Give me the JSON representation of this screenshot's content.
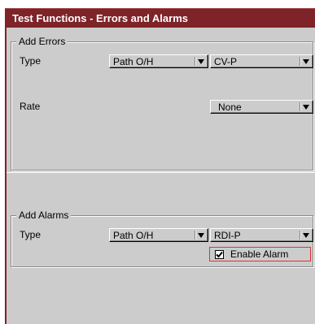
{
  "window": {
    "title": "Test Functions - Errors and Alarms"
  },
  "errors": {
    "legend": "Add Errors",
    "type_label": "Type",
    "type_primary": "Path O/H",
    "type_secondary": "CV-P",
    "rate_label": "Rate",
    "rate_value": "None"
  },
  "alarms": {
    "legend": "Add Alarms",
    "type_label": "Type",
    "type_primary": "Path O/H",
    "type_secondary": "RDI-P",
    "enable_label": "Enable Alarm",
    "enable_checked": true
  },
  "colors": {
    "titlebar": "#7e2328",
    "panel": "#cccccc",
    "highlight_border": "#e53030"
  },
  "icons": {
    "dropdown": "chevron-down-icon",
    "check": "checkmark-icon"
  }
}
